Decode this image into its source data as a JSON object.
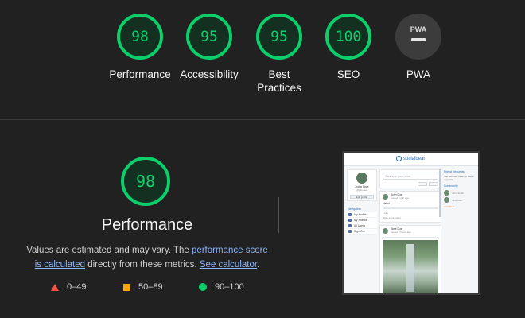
{
  "colors": {
    "background": "#212121",
    "pass": "#0cce6b",
    "average": "#ffa400",
    "fail": "#ff4e42",
    "link": "#8ab4f8"
  },
  "gauges": [
    {
      "score": "98",
      "label": "Performance",
      "value": 98
    },
    {
      "score": "95",
      "label": "Accessibility",
      "value": 95
    },
    {
      "score": "95",
      "label": "Best Practices",
      "value": 95
    },
    {
      "score": "100",
      "label": "SEO",
      "value": 100
    }
  ],
  "pwa": {
    "badge_text": "PWA",
    "label": "PWA",
    "icon": "pwa-badge-icon"
  },
  "performance": {
    "score": "98",
    "value": 98,
    "title": "Performance",
    "desc_prefix": "Values are estimated and may vary. The ",
    "link_score": "performance score is calculated",
    "desc_middle": " directly from these metrics. ",
    "link_calculator": "See calculator",
    "desc_suffix": "."
  },
  "legend": [
    {
      "range": "0–49",
      "icon": "triangle-icon"
    },
    {
      "range": "50–89",
      "icon": "square-icon"
    },
    {
      "range": "90–100",
      "icon": "circle-icon"
    }
  ],
  "thumbnail": {
    "logo": "socialbear",
    "profile_name": "John Doe",
    "profile_sub": "@johndoe",
    "profile_btn": "Edit profile",
    "post_placeholder": "What's on your mind",
    "nav_header": "Navigation",
    "nav_items": [
      "My Profile",
      "My Friends",
      "All Users",
      "Sign Out"
    ],
    "post1_user": "John Doe",
    "post1_time": "posted 5 min ago",
    "post1_text": "Hello!",
    "post1_likes": "1 like",
    "post1_comment": "Write a comment",
    "post2_user": "Jane Doe",
    "post2_time": "posted 2 hours ago",
    "right_h1": "Friend Requests",
    "right_t1": "You currently have no friend requests",
    "right_h2": "Community",
    "right_u1": "John Smith",
    "right_u2": "Jane Doe",
    "right_link": "socialbear"
  }
}
